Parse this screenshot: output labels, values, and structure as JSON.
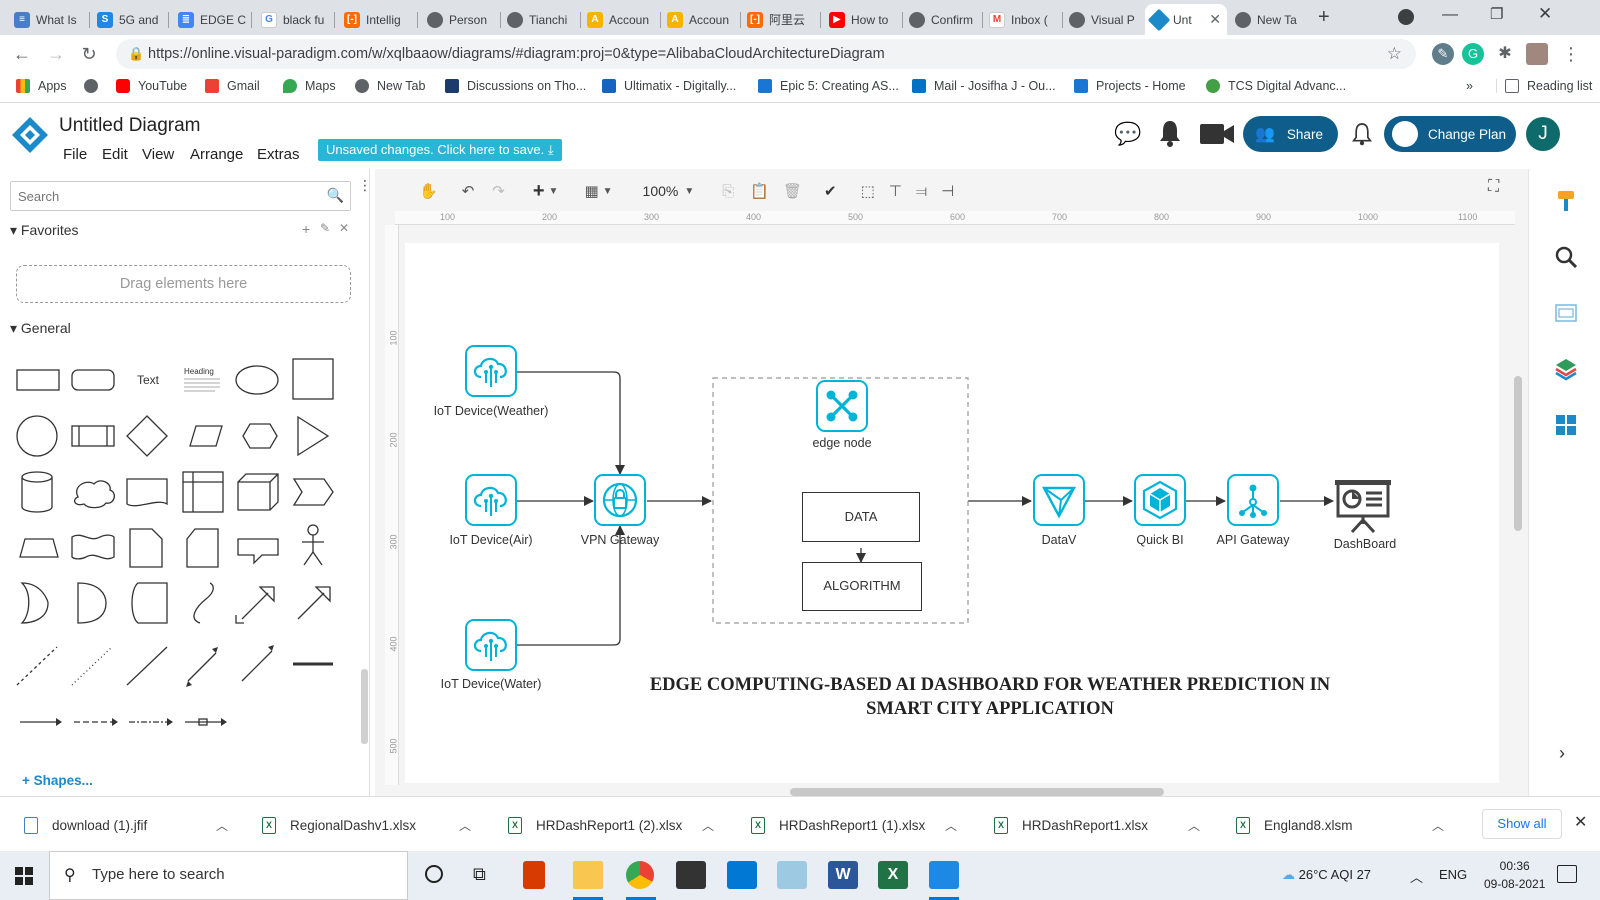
{
  "browser": {
    "tabs": [
      {
        "title": "What Is",
        "icon": "news-icon",
        "color": "#4a7dc9"
      },
      {
        "title": "5G and",
        "icon": "s-icon",
        "color": "#1e88e5"
      },
      {
        "title": "EDGE C",
        "icon": "docs-icon",
        "color": "#4285f4"
      },
      {
        "title": "black fu",
        "icon": "google-icon",
        "color": "#ea4335"
      },
      {
        "title": "Intellig",
        "icon": "alibaba-icon",
        "color": "#ff6a00"
      },
      {
        "title": "Person",
        "icon": "globe-icon",
        "color": "#5f6368"
      },
      {
        "title": "Tianchi",
        "icon": "globe-icon",
        "color": "#5f6368"
      },
      {
        "title": "Accoun",
        "icon": "account-icon",
        "color": "#f4b400"
      },
      {
        "title": "Accoun",
        "icon": "account-icon",
        "color": "#f4b400"
      },
      {
        "title": "阿里云",
        "icon": "alibaba-icon",
        "color": "#ff6a00"
      },
      {
        "title": "How to",
        "icon": "youtube-icon",
        "color": "#ff0000"
      },
      {
        "title": "Confirm",
        "icon": "globe-icon",
        "color": "#5f6368"
      },
      {
        "title": "Inbox (",
        "icon": "gmail-icon",
        "color": "#ea4335"
      },
      {
        "title": "Visual P",
        "icon": "globe-icon",
        "color": "#5f6368"
      },
      {
        "title": "Unt",
        "icon": "vp-icon",
        "color": "#1c8ac9"
      },
      {
        "title": "New Ta",
        "icon": "chrome-icon",
        "color": "#5f6368"
      }
    ],
    "url": "https://online.visual-paradigm.com/w/xqlbaaow/diagrams/#diagram:proj=0&type=AlibabaCloudArchitectureDiagram",
    "bookmarks": [
      {
        "label": "Apps",
        "color": "#ea4335"
      },
      {
        "label": "",
        "color": "#5f6368"
      },
      {
        "label": "YouTube",
        "color": "#ff0000"
      },
      {
        "label": "Gmail",
        "color": "#ea4335"
      },
      {
        "label": "Maps",
        "color": "#34a853"
      },
      {
        "label": "New Tab",
        "color": "#5f6368"
      },
      {
        "label": "Discussions on Tho...",
        "color": "#1c3a6b"
      },
      {
        "label": "Ultimatix - Digitally...",
        "color": "#1565c0"
      },
      {
        "label": "Epic 5: Creating AS...",
        "color": "#1976d2"
      },
      {
        "label": "Mail - Josifha J - Ou...",
        "color": "#0072c6"
      },
      {
        "label": "Projects - Home",
        "color": "#1976d2"
      },
      {
        "label": "TCS Digital Advanc...",
        "color": "#43a047"
      }
    ],
    "reading_list": "Reading list",
    "more": "»"
  },
  "app": {
    "title": "Untitled Diagram",
    "menus": [
      "File",
      "Edit",
      "View",
      "Arrange",
      "Extras"
    ],
    "unsaved": "Unsaved changes. Click here to save.",
    "share": "Share",
    "change_plan": "Change Plan",
    "avatar": "J",
    "zoom": "100%"
  },
  "left_panel": {
    "search_placeholder": "Search",
    "favorites": "Favorites",
    "drag_hint": "Drag elements here",
    "general": "General",
    "text_shape": "Text",
    "heading_shape": "Heading",
    "shapes_link": "+ Shapes..."
  },
  "ruler": {
    "h_ticks": [
      "100",
      "200",
      "300",
      "400",
      "500",
      "600",
      "700",
      "800",
      "900",
      "1000",
      "1100"
    ],
    "v_ticks": [
      "100",
      "200",
      "300",
      "400",
      "500"
    ]
  },
  "diagram": {
    "nodes": {
      "weather": "IoT Device(Weather)",
      "air": "IoT Device(Air)",
      "water": "IoT Device(Water)",
      "vpn": "VPN Gateway",
      "edge": "edge node",
      "data": "DATA",
      "algorithm": "ALGORITHM",
      "datav": "DataV",
      "quickbi": "Quick BI",
      "api": "API Gateway",
      "dashboard": "DashBoard"
    },
    "title_line1": "EDGE COMPUTING-BASED AI DASHBOARD FOR WEATHER PREDICTION IN",
    "title_line2": "SMART CITY APPLICATION",
    "accent": "#00b4d8"
  },
  "downloads": {
    "items": [
      "download (1).jfif",
      "RegionalDashv1.xlsx",
      "HRDashReport1 (2).xlsx",
      "HRDashReport1 (1).xlsx",
      "HRDashReport1.xlsx",
      "England8.xlsm"
    ],
    "show_all": "Show all"
  },
  "taskbar": {
    "search_placeholder": "Type here to search",
    "weather": "26°C  AQI 27",
    "lang": "ENG",
    "time": "00:36",
    "date": "09-08-2021"
  }
}
